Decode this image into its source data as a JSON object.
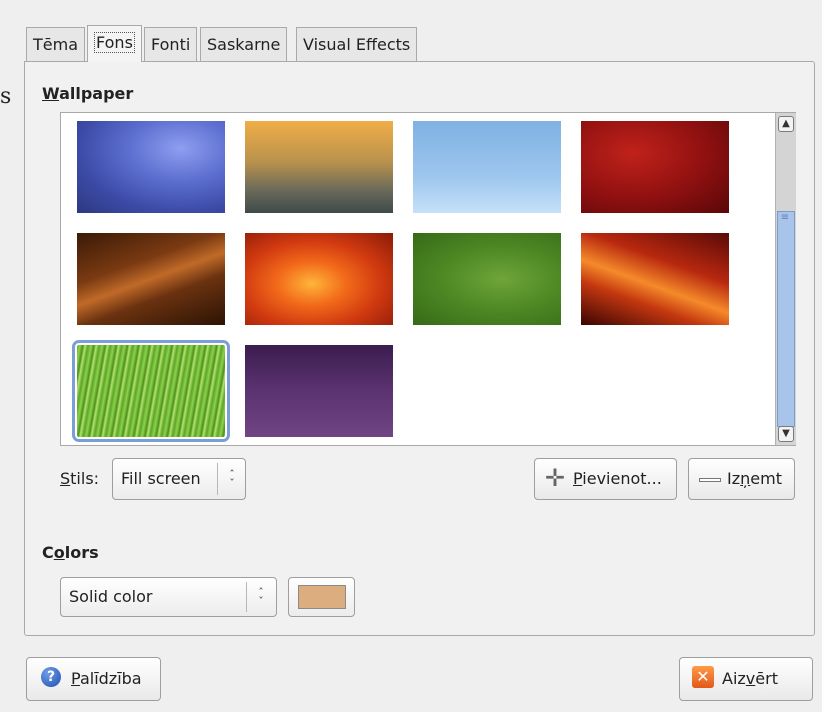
{
  "window": {
    "edge_glyph": "s",
    "tabs": [
      {
        "label": "Tēma",
        "active": false
      },
      {
        "label": "Fons",
        "active": true
      },
      {
        "label": "Fonti",
        "active": false
      },
      {
        "label": "Saskarne",
        "active": false
      },
      {
        "label": "Visual Effects",
        "active": false
      }
    ]
  },
  "wallpaper": {
    "section_title_key": "W",
    "section_title_rest": "allpaper",
    "thumbnails": [
      {
        "name": "blue-swirl",
        "selected": false
      },
      {
        "name": "amber-dots",
        "selected": false
      },
      {
        "name": "light-blue-dots",
        "selected": false
      },
      {
        "name": "dark-red",
        "selected": false
      },
      {
        "name": "brown-waves",
        "selected": false
      },
      {
        "name": "orange-flower",
        "selected": false
      },
      {
        "name": "green-waves",
        "selected": false
      },
      {
        "name": "red-orange-rays",
        "selected": false
      },
      {
        "name": "green-grass",
        "selected": true
      },
      {
        "name": "purple-dots",
        "selected": false
      }
    ],
    "style_label_key": "S",
    "style_label_rest": "tils:",
    "style_value": "Fill screen",
    "add_label_key": "P",
    "add_label_rest": "ievienot...",
    "remove_label_pre": "Iz",
    "remove_label_key": "ņ",
    "remove_label_rest": "emt"
  },
  "colors": {
    "section_title_pre": "C",
    "section_title_key": "o",
    "section_title_rest": "lors",
    "mode_value": "Solid color",
    "swatch_color": "#dcae7f"
  },
  "footer": {
    "help_label_key": "P",
    "help_label_rest": "alīdzība",
    "close_label_pre": "Aiz",
    "close_label_key": "v",
    "close_label_rest": "ērt"
  },
  "icons": [
    "plus-icon",
    "minus-icon",
    "help-icon",
    "close-icon",
    "updown-arrows-icon",
    "scroll-up-icon",
    "scroll-down-icon"
  ]
}
